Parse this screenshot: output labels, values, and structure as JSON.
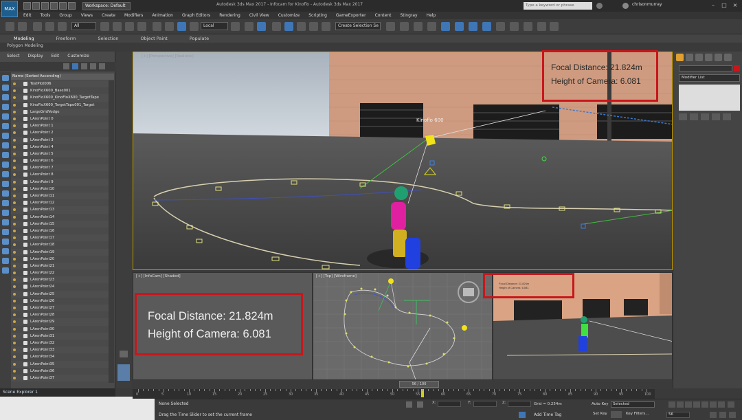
{
  "app": {
    "logo": "MAX",
    "workspace": "Workspace: Default",
    "window_title": "Autodesk 3ds Max 2017 - Infocam for Kinoflo  - Autodesk 3ds Max 2017",
    "search_placeholder": "Type a keyword or phrase",
    "user": "chrisonmurray",
    "icons": [
      "undo-icon",
      "redo-icon",
      "link-icon",
      "select-icon",
      "move-icon",
      "rotate-icon",
      "scale-icon"
    ]
  },
  "menu": [
    "Edit",
    "Tools",
    "Group",
    "Views",
    "Create",
    "Modifiers",
    "Animation",
    "Graph Editors",
    "Rendering",
    "Civil View",
    "Customize",
    "Scripting",
    "GameExporter",
    "Content",
    "Stingray",
    "Help"
  ],
  "toolbar": {
    "filter": "All",
    "ref_coord": "Local",
    "selection_set": "Create Selection Se"
  },
  "ribbon": {
    "tabs": [
      "Modeling",
      "Freeform",
      "Selection",
      "Object Paint",
      "Populate"
    ],
    "panel": "Polygon Modeling"
  },
  "explorer": {
    "menu": [
      "Select",
      "Display",
      "Edit",
      "Customize"
    ],
    "header": "Name (Sorted Ascending)",
    "items": [
      "TestPlot006",
      "KinoFloX600_Base001",
      "KinoFloX600_KinoFloX600_TargetTape",
      "KinoFloX600_TargetTape001_Target",
      "LargeGridVedge",
      "LArenPoint 0",
      "LArenPoint 1",
      "LArenPoint 2",
      "LArenPoint 3",
      "LArenPoint 4",
      "LArenPoint 5",
      "LArenPoint 6",
      "LArenPoint 7",
      "LArenPoint 8",
      "LArenPoint 9",
      "LArenPoint10",
      "LArenPoint11",
      "LArenPoint12",
      "LArenPoint13",
      "LArenPoint14",
      "LArenPoint15",
      "LArenPoint16",
      "LArenPoint17",
      "LArenPoint18",
      "LArenPoint19",
      "LArenPoint20",
      "LArenPoint21",
      "LArenPoint22",
      "LArenPoint23",
      "LArenPoint24",
      "LArenPoint25",
      "LArenPoint26",
      "LArenPoint27",
      "LArenPoint28",
      "LArenPoint29",
      "LArenPoint30",
      "LArenPoint31",
      "LArenPoint32",
      "LArenPoint33",
      "LArenPoint34",
      "LArenPoint35",
      "LArenPoint36",
      "LArenPoint37"
    ],
    "footer": "Scene Explorer 1"
  },
  "viewports": {
    "main_label": "[+] [Perspective] [Realistic]",
    "light_label": "Kinoflo 600",
    "bl_label": "[+] [InfoCam] [Shaded]",
    "bm_label": "[+] [Top] [Wireframe]",
    "info": {
      "focal": "Focal Distance: 21.824m",
      "height": "Height of Camera: 6.081"
    }
  },
  "command_panel": {
    "modifier_list": "Modifier List"
  },
  "timeline": {
    "slider": "56 / 100",
    "ticks": [
      "0",
      "5",
      "10",
      "15",
      "20",
      "25",
      "30",
      "35",
      "40",
      "45",
      "50",
      "55",
      "60",
      "65",
      "70",
      "75",
      "80",
      "85",
      "90",
      "95",
      "100"
    ]
  },
  "status": {
    "selection": "None Selected",
    "prompt": "Drag the Time Slider to set the current frame",
    "x": "X:",
    "y": "Y:",
    "z": "Z:",
    "grid": "Grid = 0.254m",
    "add_time_tag": "Add Time Tag",
    "auto_key": "Auto Key",
    "selected": "Selected",
    "set_key": "Set Key",
    "key_filters": "Key Filters...",
    "frame": "56"
  }
}
